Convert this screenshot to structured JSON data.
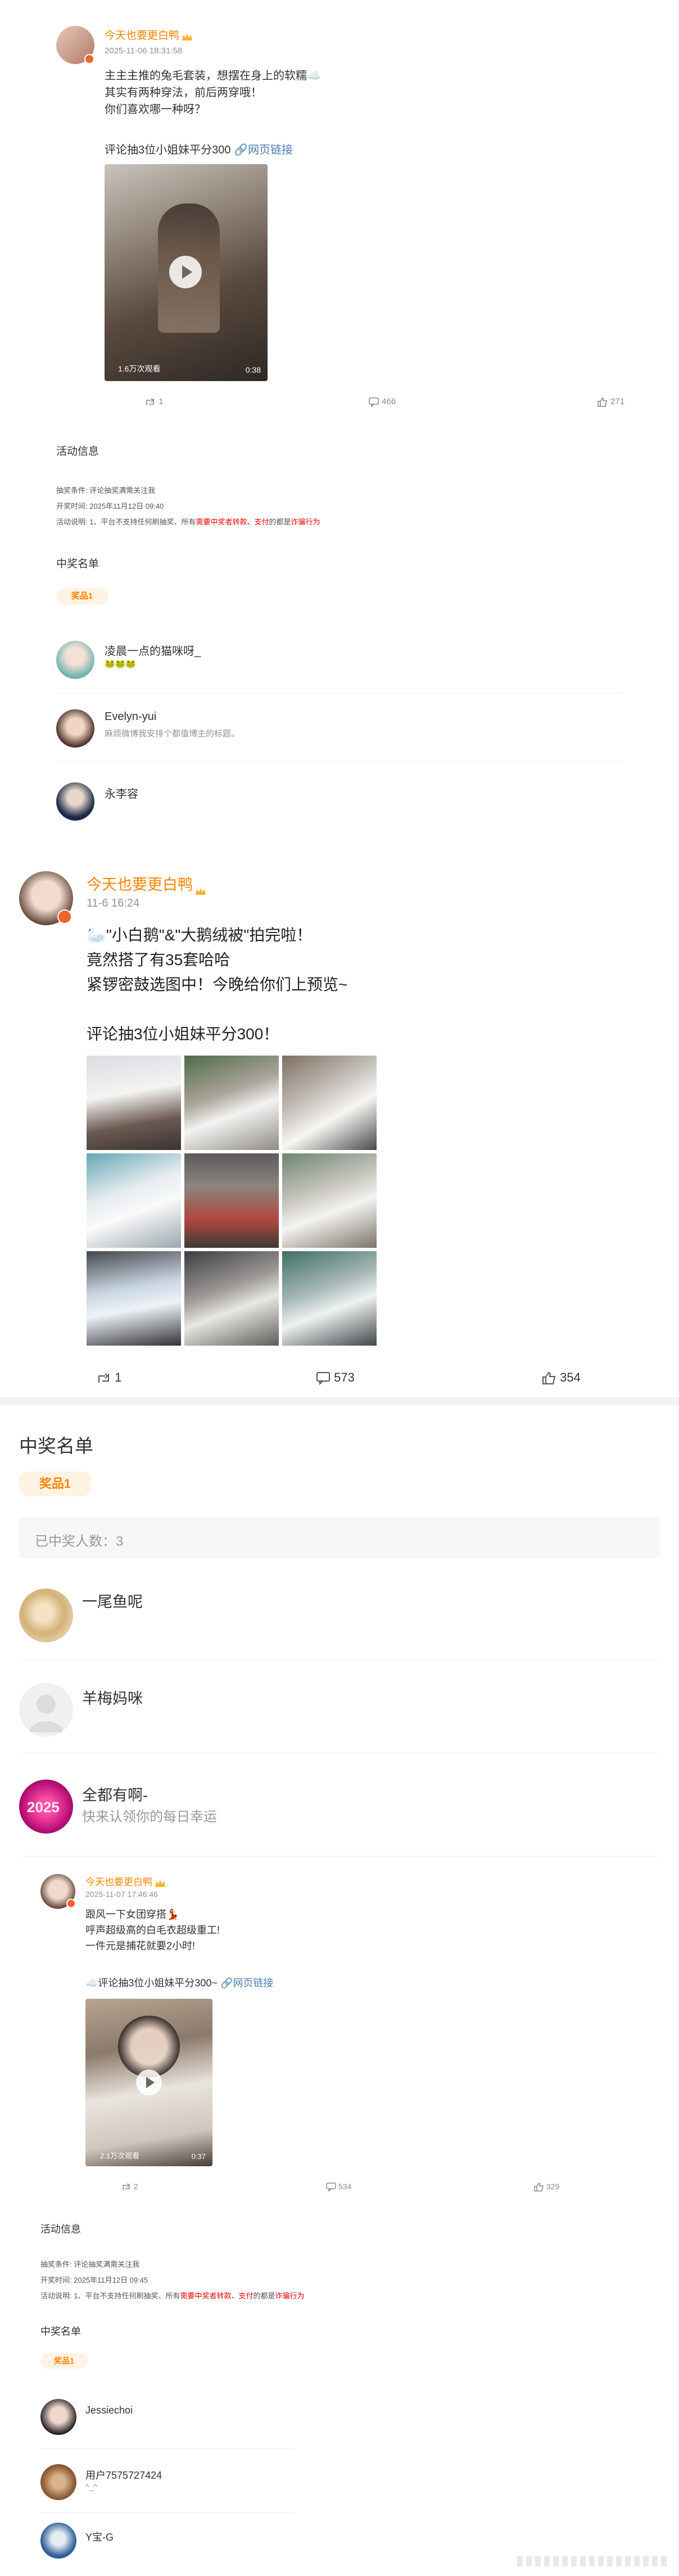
{
  "post1": {
    "author": "今天也要更白鸭",
    "time": "2025-11-06 18:31:58",
    "lines": [
      "主主主推的兔毛套装，想摆在身上的软糯☁️",
      "其实有两种穿法，前后两穿哦！",
      "你们喜欢哪一种呀？"
    ],
    "lottery": "评论抽3位小姐妹平分300",
    "weblink": "网页链接",
    "video_views": "1.6万次观看",
    "video_duration": "0:38",
    "repost_count": "1",
    "comment_count": "466",
    "like_count": "271",
    "activity_title": "活动信息",
    "cond_label": "抽奖条件:",
    "cond_value": "评论抽奖满需关注我",
    "draw_label": "开奖时间:",
    "draw_value": "2025年11月12日 09:40",
    "desc_label": "活动说明:",
    "desc_prefix": "1、平台不支持任何刷抽奖、所有",
    "desc_red1": "需要中奖者转款、支付",
    "desc_mid": "的都是",
    "desc_red2": "诈骗行为",
    "winners_title": "中奖名单",
    "prize_badge": "奖品1",
    "winners": [
      {
        "name": "凌晨一点的猫咪呀_",
        "sub": "🐸🐸🐸"
      },
      {
        "name": "Evelyn-yui",
        "sub": "麻烦微博我安排个都值博主的标题。"
      },
      {
        "name": "永李容",
        "sub": ""
      }
    ]
  },
  "post2": {
    "author": "今天也要更白鸭",
    "time": "11-6 16:24",
    "lines": [
      "🦢\"小白鹅\"&\"大鹅绒被\"拍完啦！",
      "竟然搭了有35套哈哈",
      "紧锣密鼓选图中！今晚给你们上预览~"
    ],
    "lottery": "评论抽3位小姐妹平分300！",
    "repost_count": "1",
    "comment_count": "573",
    "like_count": "354"
  },
  "winners_section": {
    "title": "中奖名单",
    "prize_badge": "奖品1",
    "count_text": "已中奖人数：3",
    "winners": [
      {
        "name": "一尾鱼呢",
        "sub": ""
      },
      {
        "name": "羊梅妈咪",
        "sub": ""
      },
      {
        "name": "全都有啊-",
        "sub": "快来认领你的每日幸运"
      }
    ],
    "avatar3_text": "2025"
  },
  "post3": {
    "author": "今天也要更白鸭",
    "time": "2025-11-07 17:46:46",
    "lines": [
      "跟风一下女团穿搭💃",
      "呼声超级高的白毛衣超级重工!",
      "一件元是捕花就要2小时!"
    ],
    "lottery": "☁️评论抽3位小姐妹平分300~",
    "weblink": "网页链接",
    "video_views": "2.1万次观看",
    "video_duration": "0:37",
    "repost_count": "2",
    "comment_count": "534",
    "like_count": "329",
    "activity_title": "活动信息",
    "cond_label": "抽奖条件:",
    "cond_value": "评论抽奖满需关注我",
    "draw_label": "开奖时间:",
    "draw_value": "2025年11月12日 09:45",
    "desc_label": "活动说明:",
    "desc_prefix": "1、平台不支持任何刷抽奖、所有",
    "desc_red1": "需要中奖者转款、支付",
    "desc_mid": "的都是",
    "desc_red2": "诈骗行为",
    "winners_title": "中奖名单",
    "prize_badge": "奖品1",
    "winners": [
      {
        "name": "Jessiechoi",
        "sub": ""
      },
      {
        "name": "用户7575727424",
        "sub": "^_^"
      },
      {
        "name": "Y宝-G",
        "sub": ""
      }
    ]
  },
  "colors": {
    "brand": "#ff8200",
    "link": "#507daf",
    "warning": "#e00000"
  }
}
